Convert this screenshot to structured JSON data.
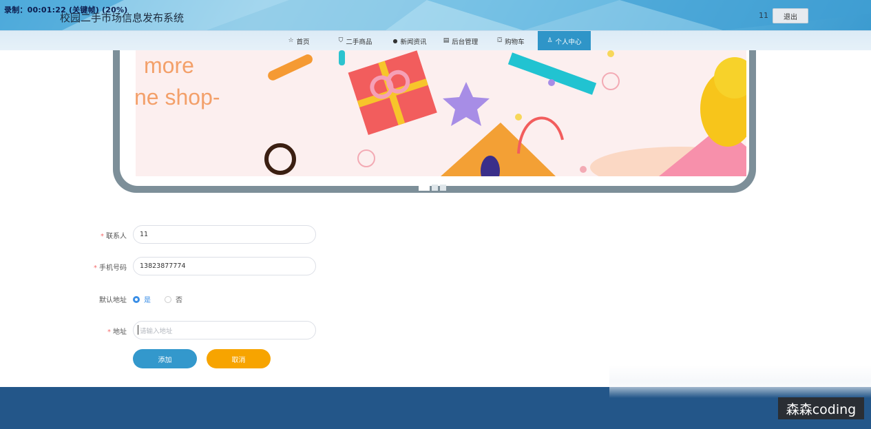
{
  "header": {
    "recording_overlay": "录制：00:01:22 (关键帧) (20%)",
    "site_title": "校园二手市场信息发布系统",
    "user_name": "11",
    "logout_label": "退出"
  },
  "nav": {
    "items": [
      {
        "label": "首页",
        "icon": "star-icon",
        "glyph": "☆",
        "active": false
      },
      {
        "label": "二手商品",
        "icon": "bag-icon",
        "glyph": "⛉",
        "active": false
      },
      {
        "label": "新闻资讯",
        "icon": "info-icon",
        "glyph": "●",
        "active": false
      },
      {
        "label": "后台管理",
        "icon": "calendar-icon",
        "glyph": "▤",
        "active": false
      },
      {
        "label": "购物车",
        "icon": "cart-icon",
        "glyph": "⛋",
        "active": false
      },
      {
        "label": "个人中心",
        "icon": "user-icon",
        "glyph": "♙",
        "active": true
      }
    ]
  },
  "banner": {
    "text_line1": "more",
    "text_line2": "ne shop-",
    "active_slide": 1,
    "slide_count": 3
  },
  "form": {
    "contact": {
      "label": "联系人",
      "required": true,
      "value": "11"
    },
    "phone": {
      "label": "手机号码",
      "required": true,
      "value": "13823877774"
    },
    "default_address": {
      "label": "默认地址",
      "options": [
        "是",
        "否"
      ],
      "selected": "是"
    },
    "address": {
      "label": "地址",
      "required": true,
      "value": "",
      "placeholder": "请输入地址"
    },
    "add_label": "添加",
    "cancel_label": "取消"
  },
  "watermark": "森森coding",
  "colors": {
    "nav_active": "#2f95c8",
    "add_button": "#3398cc",
    "cancel_button": "#f7a400",
    "footer": "#235689",
    "required": "#f56c6c",
    "radio_checked": "#3a8ee6"
  }
}
